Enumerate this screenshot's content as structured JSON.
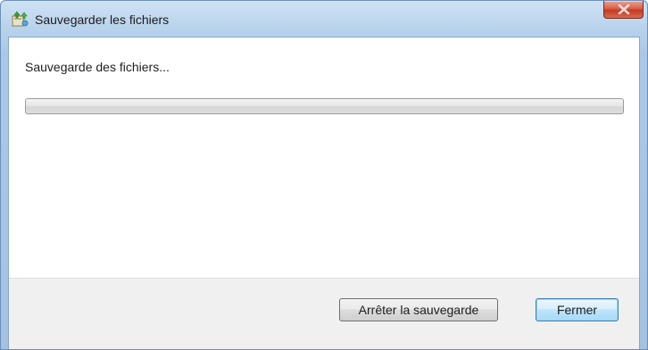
{
  "window": {
    "title": "Sauvegarder les fichiers",
    "app_icon": "backup-app-icon",
    "close_icon": "close-x-icon",
    "close_color": "#c43a22"
  },
  "content": {
    "status": "Sauvegarde des fichiers...",
    "progress": {
      "value": 0,
      "max": 100
    }
  },
  "footer": {
    "stop_button": "Arrêter la sauvegarde",
    "close_button": "Fermer"
  }
}
